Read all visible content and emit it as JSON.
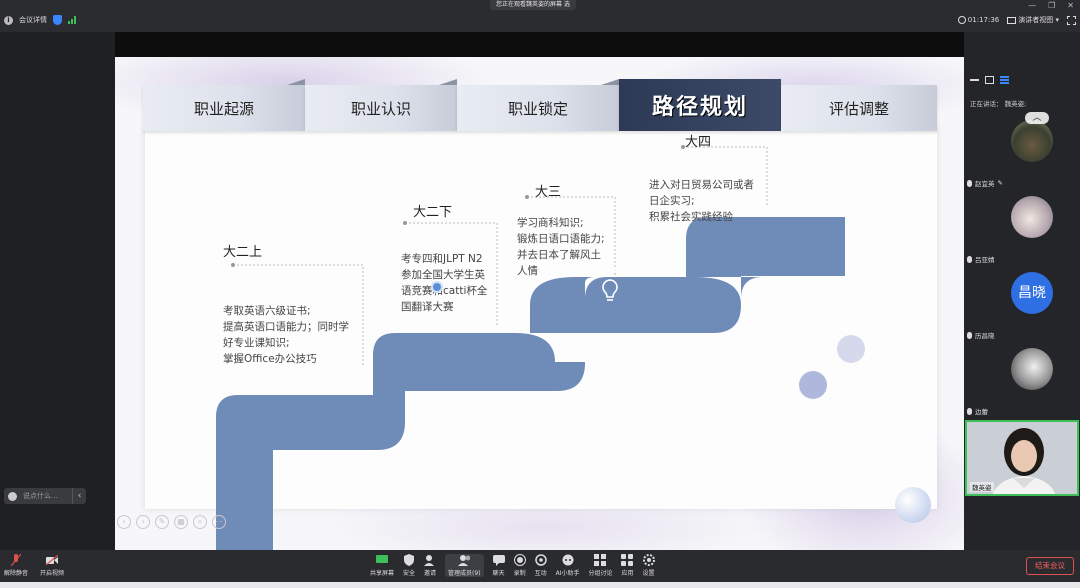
{
  "topbar": {
    "meeting_info": "会议详情",
    "banner": "您正在观看魏英姿的屏幕",
    "banner_menu": "选",
    "timer": "01:17:36",
    "view_mode": "演讲者视图"
  },
  "slide": {
    "tabs": [
      "职业起源",
      "职业认识",
      "职业锁定",
      "路径规划",
      "评估调整"
    ],
    "active_tab": "路径规划",
    "steps": [
      {
        "label": "大二上",
        "desc": [
          "考取英语六级证书;",
          "提高英语口语能力；同时学",
          "好专业课知识;",
          "掌握Office办公技巧"
        ]
      },
      {
        "label": "大二下",
        "desc": [
          "考专四和JLPT N2",
          "参加全国大学生英",
          "语竞赛和catti杯全",
          "国翻译大赛"
        ]
      },
      {
        "label": "大三",
        "desc": [
          "学习商科知识;",
          "锻炼日语口语能力;",
          "并去日本了解风土",
          "人情"
        ]
      },
      {
        "label": "大四",
        "desc": [
          "进入对日贸易公司或者",
          "日企实习;",
          "积累社会实践经验"
        ]
      }
    ],
    "colors": {
      "stair": "#6f8bb8",
      "active_tab": "#2d3a55"
    }
  },
  "chat": {
    "placeholder": "说点什么..."
  },
  "right_panel": {
    "speaking_label": "正在讲话：",
    "speaking_name": "魏英姿;",
    "participants": [
      {
        "name": "赵宜英"
      },
      {
        "name": "吕亚婧"
      },
      {
        "name": "历昌晓",
        "initials": "昌晓"
      },
      {
        "name": "边蕾"
      },
      {
        "name": "魏英姿"
      }
    ]
  },
  "bottombar": {
    "left": [
      "解除静音",
      "开启视频"
    ],
    "center": [
      "共享屏幕",
      "安全",
      "邀请",
      "管理成员(9)",
      "聊天",
      "录制",
      "互动",
      "AI小助手",
      "分组讨论",
      "应用",
      "设置"
    ],
    "end": "结束会议"
  }
}
